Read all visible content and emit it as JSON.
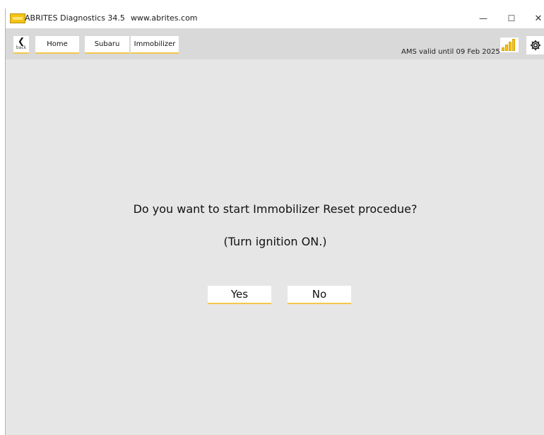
{
  "window": {
    "app_title": "ABRITES Diagnostics 34.5",
    "url": "www.abrites.com",
    "minimize_glyph": "—",
    "maximize_glyph": "☐",
    "close_glyph": "✕"
  },
  "toolbar": {
    "back_label": "back",
    "back_glyph": "❮",
    "breadcrumbs": [
      "Home",
      "Subaru",
      "Immobilizer"
    ],
    "ams_status": "AMS valid until 09 Feb 2025",
    "signal_icon": "signal-strength-icon",
    "settings_icon": "gear-icon"
  },
  "dialog": {
    "question": "Do you want to start Immobilizer Reset procedue?",
    "hint": "(Turn ignition ON.)",
    "yes_label": "Yes",
    "no_label": "No"
  },
  "colors": {
    "accent": "#f2c84b",
    "background": "#e6e6e6",
    "toolbar": "#d9d9d9"
  }
}
